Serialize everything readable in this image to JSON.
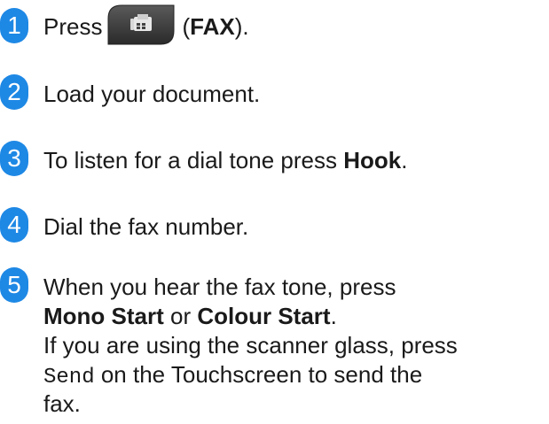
{
  "steps": [
    {
      "number": "1",
      "prefix": "Press",
      "open_paren": "(",
      "button_label": "FAX",
      "close": ")."
    },
    {
      "number": "2",
      "text": "Load your document."
    },
    {
      "number": "3",
      "prefix": "To listen for a dial tone press ",
      "bold": "Hook",
      "suffix": "."
    },
    {
      "number": "4",
      "text": "Dial the fax number."
    },
    {
      "number": "5",
      "line1": "When you hear the fax tone, press",
      "mono_start": "Mono Start",
      "or": " or ",
      "colour_start": "Colour Start",
      "period": ".",
      "line3": "If you are using the scanner glass, press",
      "send": "Send",
      "line4_rest": " on the Touchscreen to send the",
      "line5": "fax."
    }
  ],
  "colors": {
    "badge": "#1e88e5",
    "fax_button": "#3a3a3a"
  },
  "icons": {
    "fax_button": "fax-icon"
  }
}
